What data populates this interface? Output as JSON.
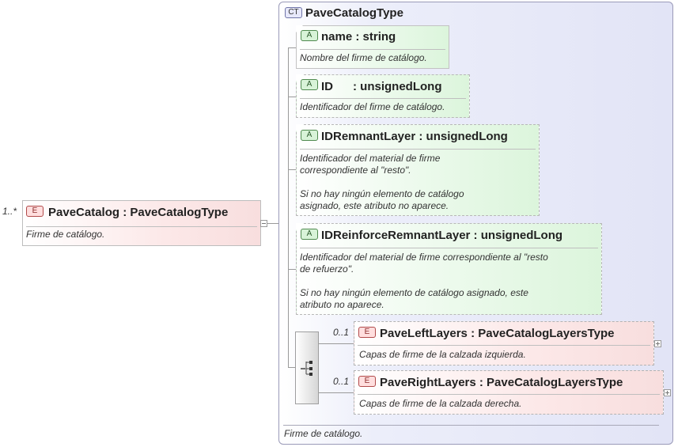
{
  "root": {
    "cardinality": "1..*",
    "badge": "E",
    "title": "PaveCatalog : PaveCatalogType",
    "note": "Firme de catálogo."
  },
  "complex_type": {
    "badge": "CT",
    "title": "PaveCatalogType",
    "footer_note": "Firme de catálogo."
  },
  "attributes": [
    {
      "badge": "A",
      "title": "name : string",
      "note": "Nombre del firme de catálogo."
    },
    {
      "badge": "A",
      "title": "ID      : unsignedLong",
      "note": "Identificador del firme de catálogo."
    },
    {
      "badge": "A",
      "title": "IDRemnantLayer : unsignedLong",
      "note": "Identificador del material de firme\ncorrespondiente al \"resto\".\n\nSi no hay ningún elemento de catálogo\nasignado, este atributo no aparece."
    },
    {
      "badge": "A",
      "title": "IDReinforceRemnantLayer : unsignedLong",
      "note": "Identificador del material de firme correspondiente al \"resto\nde refuerzo\".\n\nSi no hay ningún elemento de catálogo asignado, este\natributo no aparece."
    }
  ],
  "children": [
    {
      "cardinality": "0..1",
      "badge": "E",
      "title": "PaveLeftLayers : PaveCatalogLayersType",
      "note": "Capas de firme de la calzada izquierda."
    },
    {
      "cardinality": "0..1",
      "badge": "E",
      "title": "PaveRightLayers : PaveCatalogLayersType",
      "note": "Capas de firme de la calzada derecha."
    }
  ],
  "icons": {
    "sequence": "sequence-compositor-icon",
    "collapse": "collapse-icon",
    "expand": "expand-icon"
  }
}
